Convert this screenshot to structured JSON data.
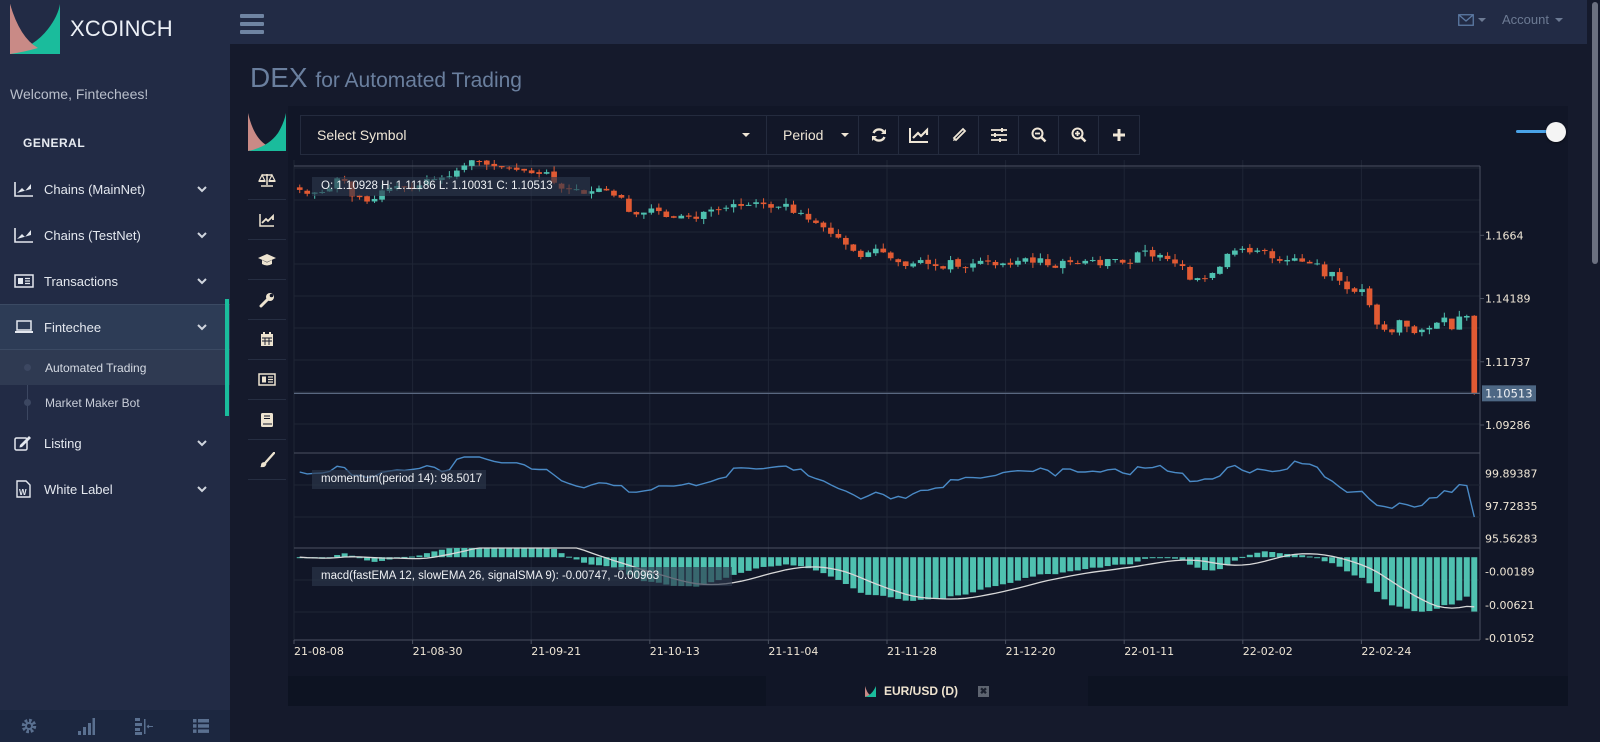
{
  "brand": {
    "name": "XCOINCH",
    "colors": {
      "pink": "#c98a86",
      "teal": "#1abc9c"
    }
  },
  "sidebar": {
    "welcome": "Welcome, Fintechees!",
    "section": "GENERAL",
    "items": [
      {
        "label": "Chains (MainNet)",
        "icon": "line-chart-icon"
      },
      {
        "label": "Chains (TestNet)",
        "icon": "line-chart-icon"
      },
      {
        "label": "Transactions",
        "icon": "newspaper-icon"
      },
      {
        "label": "Fintechee",
        "icon": "laptop-icon",
        "active": true,
        "children": [
          {
            "label": "Automated Trading",
            "current": true
          },
          {
            "label": "Market Maker Bot"
          }
        ]
      },
      {
        "label": "Listing",
        "icon": "edit-icon"
      },
      {
        "label": "White Label",
        "icon": "word-file-icon"
      }
    ],
    "footer": [
      "gear-icon",
      "signal-icon",
      "align-icon",
      "list-icon"
    ]
  },
  "topnav": {
    "account": "Account",
    "mail_icon": "envelope-icon"
  },
  "page": {
    "title_main": "DEX",
    "title_sub": "for Automated Trading"
  },
  "toolbar": {
    "symbol_placeholder": "Select Symbol",
    "period_label": "Period",
    "buttons": [
      "refresh-icon",
      "area-chart-icon",
      "pencil-icon",
      "sliders-icon",
      "zoom-out-icon",
      "zoom-in-icon",
      "plus-icon"
    ]
  },
  "side_tools": [
    "balance-scale-icon",
    "area-chart-icon",
    "graduation-cap-icon",
    "wrench-icon",
    "calendar-icon",
    "newspaper-icon",
    "book-icon",
    "paint-brush-icon"
  ],
  "slider": {
    "value": 1.0
  },
  "bottom_tab": {
    "label": "EUR/USD (D)",
    "close": "✖"
  },
  "chart_data": {
    "type": "candlestick",
    "symbol": "EUR/USD",
    "period": "D",
    "ohlc_label": "O: 1.10928 H: 1.11186 L: 1.10031 C: 1.10513",
    "last_price": "1.10513",
    "price_ticks": [
      "1.1664",
      "1.14189",
      "1.11737",
      "1.09286"
    ],
    "price_range": [
      1.082,
      1.1925
    ],
    "x_ticks": [
      "21-08-08",
      "21-08-30",
      "21-09-21",
      "21-10-13",
      "21-11-04",
      "21-11-28",
      "21-12-20",
      "22-01-11",
      "22-02-02",
      "22-02-24"
    ],
    "colors": {
      "up": "#4fc1b0",
      "down": "#e15a33",
      "momentum": "#4a8ac6",
      "macd_hist": "#4fc1b0",
      "signal": "#d8d8d8"
    },
    "closes": [
      1.184,
      1.1825,
      1.183,
      1.1832,
      1.1845,
      1.1885,
      1.1875,
      1.1815,
      1.1812,
      1.1795,
      1.1805,
      1.1838,
      1.1848,
      1.1855,
      1.1852,
      1.1845,
      1.1858,
      1.1882,
      1.1882,
      1.1888,
      1.1892,
      1.1915,
      1.1935,
      1.1955,
      1.1951,
      1.1938,
      1.1932,
      1.1928,
      1.1925,
      1.1918,
      1.1915,
      1.1905,
      1.1902,
      1.1909,
      1.1868,
      1.1845,
      1.1843,
      1.1843,
      1.1825,
      1.1835,
      1.1846,
      1.1838,
      1.1818,
      1.181,
      1.1755,
      1.1745,
      1.1752,
      1.1768,
      1.1758,
      1.1735,
      1.1732,
      1.174,
      1.1736,
      1.1728,
      1.1755,
      1.1764,
      1.1765,
      1.1771,
      1.1785,
      1.1778,
      1.1782,
      1.1792,
      1.1785,
      1.1771,
      1.1775,
      1.1786,
      1.1751,
      1.1751,
      1.1725,
      1.1712,
      1.1695,
      1.167,
      1.1655,
      1.1628,
      1.1604,
      1.158,
      1.1598,
      1.1612,
      1.1598,
      1.1575,
      1.156,
      1.1545,
      1.1555,
      1.1568,
      1.1553,
      1.1545,
      1.1535,
      1.1568,
      1.1542,
      1.1538,
      1.1555,
      1.1565,
      1.1562,
      1.1548,
      1.1555,
      1.155,
      1.1565,
      1.1575,
      1.1558,
      1.1575,
      1.1548,
      1.1538,
      1.1565,
      1.156,
      1.1555,
      1.1565,
      1.1568,
      1.1548,
      1.1572,
      1.1572,
      1.1558,
      1.1555,
      1.1598,
      1.1605,
      1.1582,
      1.1588,
      1.1572,
      1.1555,
      1.1545,
      1.1492,
      1.1498,
      1.1495,
      1.1518,
      1.1542,
      1.1592,
      1.1605,
      1.1612,
      1.1598,
      1.1605,
      1.1603,
      1.1575,
      1.1565,
      1.1568,
      1.1575,
      1.1562,
      1.1555,
      1.1555,
      1.1505,
      1.1522,
      1.1488,
      1.1455,
      1.1445,
      1.1455,
      1.1393,
      1.1318,
      1.1298,
      1.1288,
      1.1335,
      1.131,
      1.1285,
      1.1298,
      1.1305,
      1.1325,
      1.1345,
      1.13,
      1.1349,
      1.13512,
      1.10513
    ],
    "momentum": {
      "label": "momentum(period 14): 98.5017",
      "ticks": [
        "99.89387",
        "97.72835",
        "95.56283"
      ],
      "range": [
        95.2,
        101.0
      ]
    },
    "macd": {
      "label": "macd(fastEMA 12, slowEMA 26, signalSMA 9): -0.00747, -0.00963",
      "ticks": [
        "-0.00189",
        "-0.00621",
        "-0.01052"
      ],
      "range": [
        -0.0108,
        0.0012
      ]
    }
  }
}
